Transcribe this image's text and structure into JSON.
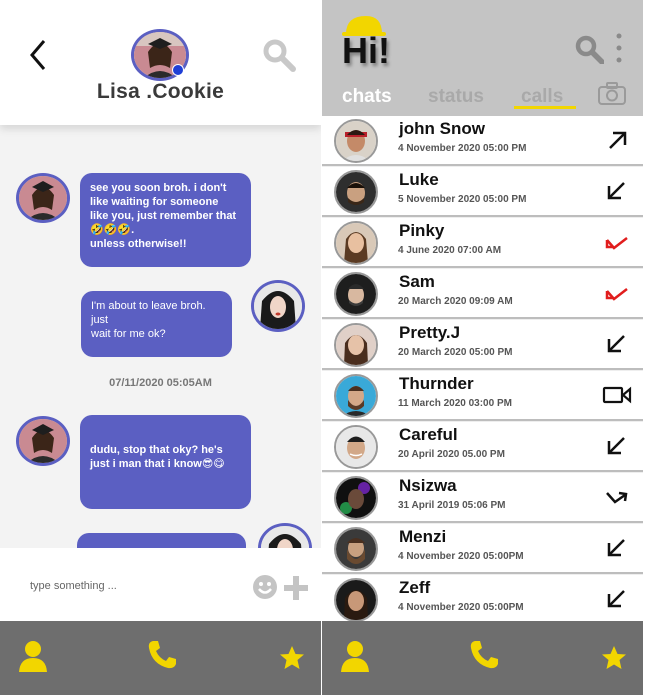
{
  "chat_screen": {
    "contact_name": "Lisa .Cookie",
    "messages": [
      {
        "side": "incoming",
        "text": "see you soon broh. i don't\nlike waiting for someone\nlike you, just remember that\n🤣🤣🤣.\nunless otherwise!!"
      },
      {
        "side": "outgoing",
        "text": "I'm about to leave broh.\njust\nwait for me ok?"
      },
      {
        "side": "incoming",
        "text": "dudu, stop that oky? he's\njust i man that i know😎😋"
      }
    ],
    "timestamp": "07/11/2020 05:05AM",
    "input_placeholder": "type something ..."
  },
  "calls_screen": {
    "title": "Hi!",
    "tabs": [
      {
        "label": "chats",
        "active": false
      },
      {
        "label": "status",
        "active": false
      },
      {
        "label": "calls",
        "active": true
      }
    ],
    "calls": [
      {
        "name": "john Snow",
        "time": "4 November 2020 05:00 PM",
        "type": "outgoing",
        "missed": false
      },
      {
        "name": "Luke",
        "time": "5 November 2020 05:00 PM",
        "type": "incoming",
        "missed": false
      },
      {
        "name": "Pinky",
        "time": "4 June  2020 07:00 AM",
        "type": "missed",
        "missed": true
      },
      {
        "name": "Sam",
        "time": "20 March 2020 09:09 AM",
        "type": "missed",
        "missed": true
      },
      {
        "name": "Pretty.J",
        "time": "20 March 2020 05:00 PM",
        "type": "incoming",
        "missed": false
      },
      {
        "name": "Thurnder",
        "time": "11 March 2020 03:00 PM",
        "type": "video",
        "missed": false
      },
      {
        "name": "Careful",
        "time": "20 April 2020 05.00 PM",
        "type": "incoming",
        "missed": false
      },
      {
        "name": "Nsizwa",
        "time": "31 April 2019 05:06 PM",
        "type": "missed-out",
        "missed": false
      },
      {
        "name": "Menzi",
        "time": "4 November 2020 05:00PM",
        "type": "incoming",
        "missed": false
      },
      {
        "name": "Zeff",
        "time": "4 November 2020 05:00PM",
        "type": "incoming",
        "missed": false
      }
    ]
  },
  "colors": {
    "bubble": "#5b5fc2",
    "accent_yellow": "#f2d600",
    "nav_bg": "#6e6e6e",
    "missed_red": "#e11d1d"
  }
}
